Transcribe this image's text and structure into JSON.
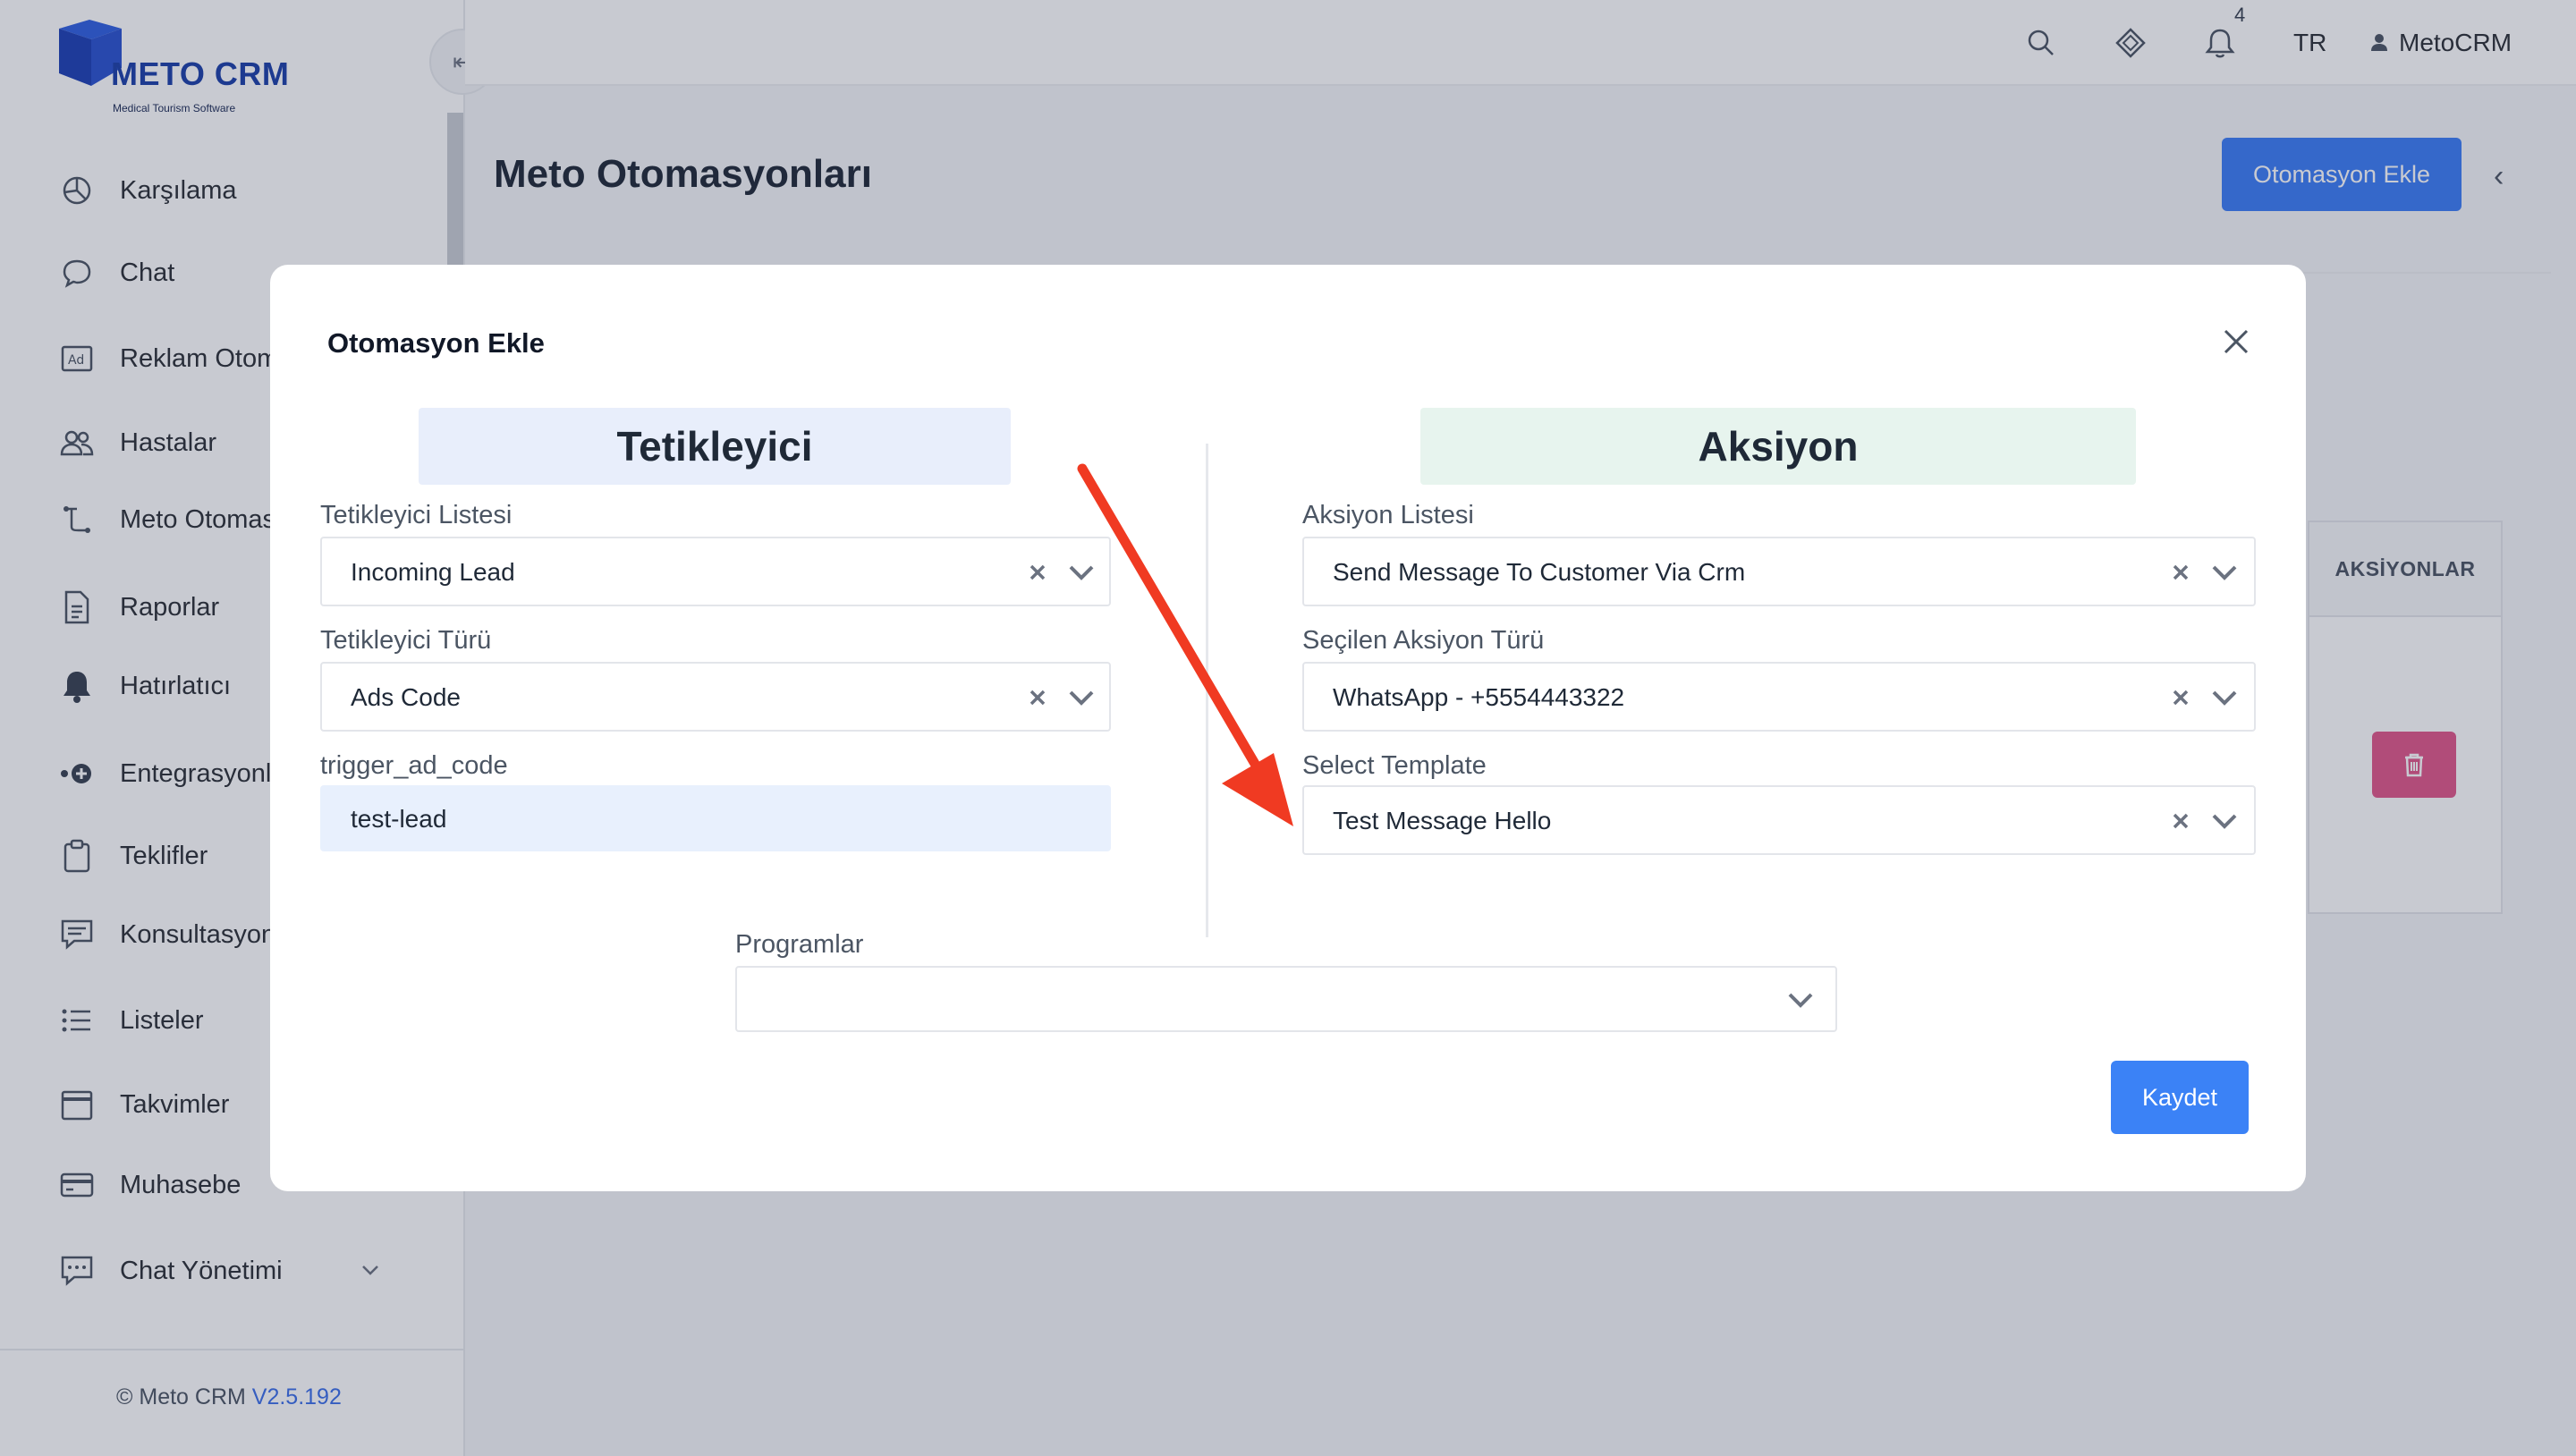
{
  "brand": {
    "name": "METO CRM",
    "tagline": "Medical Tourism Software",
    "color": "#1b3fa8"
  },
  "sidebar": {
    "items": [
      {
        "label": "Karşılama",
        "icon": "dashboard-icon"
      },
      {
        "label": "Chat",
        "icon": "chat-bubble-icon"
      },
      {
        "label": "Reklam Otom",
        "icon": "ad-icon"
      },
      {
        "label": "Hastalar",
        "icon": "users-icon"
      },
      {
        "label": "Meto Otomas",
        "icon": "automation-icon"
      },
      {
        "label": "Raporlar",
        "icon": "report-icon"
      },
      {
        "label": "Hatırlatıcı",
        "icon": "bell-icon"
      },
      {
        "label": "Entegrasyonl",
        "icon": "integration-icon"
      },
      {
        "label": "Teklifler",
        "icon": "clipboard-icon"
      },
      {
        "label": "Konsultasyon",
        "icon": "consultation-icon"
      },
      {
        "label": "Listeler",
        "icon": "list-icon"
      },
      {
        "label": "Takvimler",
        "icon": "calendar-icon"
      },
      {
        "label": "Muhasebe",
        "icon": "credit-card-icon"
      },
      {
        "label": "Chat Yönetimi",
        "icon": "chat-manage-icon"
      }
    ],
    "footer": {
      "prefix": "© Meto CRM",
      "version": "V2.5.192"
    }
  },
  "topbar": {
    "notification_count": "4",
    "language": "TR",
    "user": "MetoCRM"
  },
  "page": {
    "title": "Meto Otomasyonları",
    "add_button": "Otomasyon Ekle",
    "table_header_actions": "AKSİYONLAR"
  },
  "modal": {
    "title": "Otomasyon Ekle",
    "trigger": {
      "heading": "Tetikleyici",
      "list_label": "Tetikleyici Listesi",
      "list_value": "Incoming Lead",
      "type_label": "Tetikleyici Türü",
      "type_value": "Ads Code",
      "code_label": "trigger_ad_code",
      "code_value": "test-lead"
    },
    "action": {
      "heading": "Aksiyon",
      "list_label": "Aksiyon Listesi",
      "list_value": "Send Message To Customer Via Crm",
      "type_label": "Seçilen Aksiyon Türü",
      "type_value": "WhatsApp - +5554443322",
      "template_label": "Select Template",
      "template_value": "Test Message Hello"
    },
    "programs_label": "Programlar",
    "programs_value": "",
    "save_button": "Kaydet"
  },
  "colors": {
    "primary": "#3b7cf6",
    "danger": "#e0578a",
    "annotation_arrow": "#f03a22"
  }
}
